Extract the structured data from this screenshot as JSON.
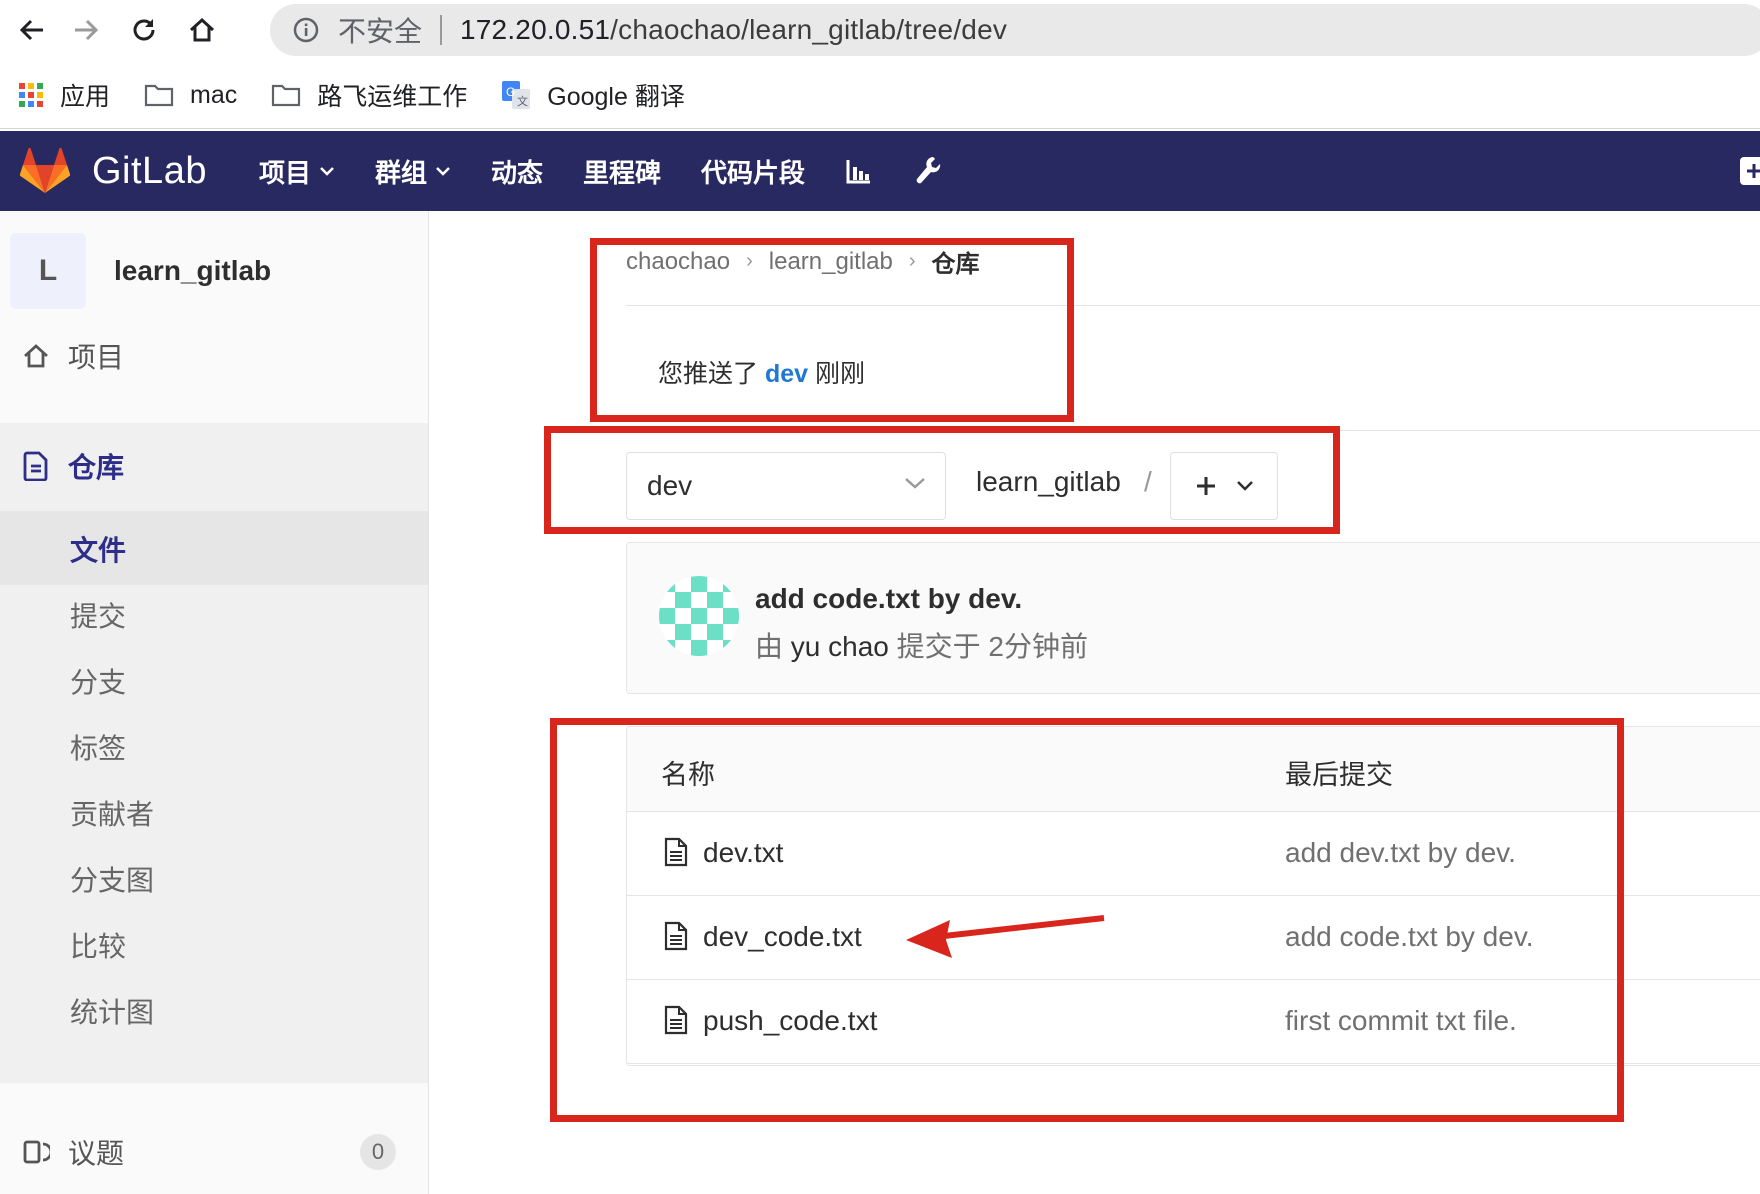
{
  "browser": {
    "insecure_label": "不安全",
    "url_host": "172.20.0.51",
    "url_path": "/chaochao/learn_gitlab/tree/dev",
    "bookmarks": [
      {
        "label": "应用",
        "icon": "apps-grid-icon"
      },
      {
        "label": "mac",
        "icon": "folder-icon"
      },
      {
        "label": "路飞运维工作",
        "icon": "folder-icon"
      },
      {
        "label": "Google 翻译",
        "icon": "google-translate-icon"
      }
    ]
  },
  "topnav": {
    "brand": "GitLab",
    "items": [
      {
        "label": "项目",
        "dropdown": true
      },
      {
        "label": "群组",
        "dropdown": true
      },
      {
        "label": "动态",
        "dropdown": false
      },
      {
        "label": "里程碑",
        "dropdown": false
      },
      {
        "label": "代码片段",
        "dropdown": false
      }
    ],
    "icons": [
      "chart-icon",
      "wrench-icon"
    ]
  },
  "sidebar": {
    "project_initial": "L",
    "project_name": "learn_gitlab",
    "items": {
      "project": "项目",
      "repository": "仓库",
      "issues": "议题",
      "issues_count": "0"
    },
    "repo_subitems": [
      "文件",
      "提交",
      "分支",
      "标签",
      "贡献者",
      "分支图",
      "比较",
      "统计图"
    ]
  },
  "breadcrumb": {
    "items": [
      "chaochao",
      "learn_gitlab"
    ],
    "current": "仓库"
  },
  "push_notice": {
    "prefix": "您推送了",
    "branch": "dev",
    "suffix": "刚刚"
  },
  "repo_toolbar": {
    "branch": "dev",
    "path": "learn_gitlab",
    "slash": "/",
    "add_symbol": "+"
  },
  "last_commit": {
    "title": "add code.txt by dev.",
    "by_prefix": "由",
    "author": "yu chao",
    "time_text": "提交于 2分钟前"
  },
  "files": {
    "header_name": "名称",
    "header_commit": "最后提交",
    "rows": [
      {
        "name": "dev.txt",
        "message": "add dev.txt by dev."
      },
      {
        "name": "dev_code.txt",
        "message": "add code.txt by dev."
      },
      {
        "name": "push_code.txt",
        "message": "first commit txt file."
      }
    ]
  },
  "colors": {
    "nav_bg": "#292961",
    "link_blue": "#1f78d1",
    "annotation_red": "#d9261c",
    "avatar_teal": "#6be0c7"
  }
}
